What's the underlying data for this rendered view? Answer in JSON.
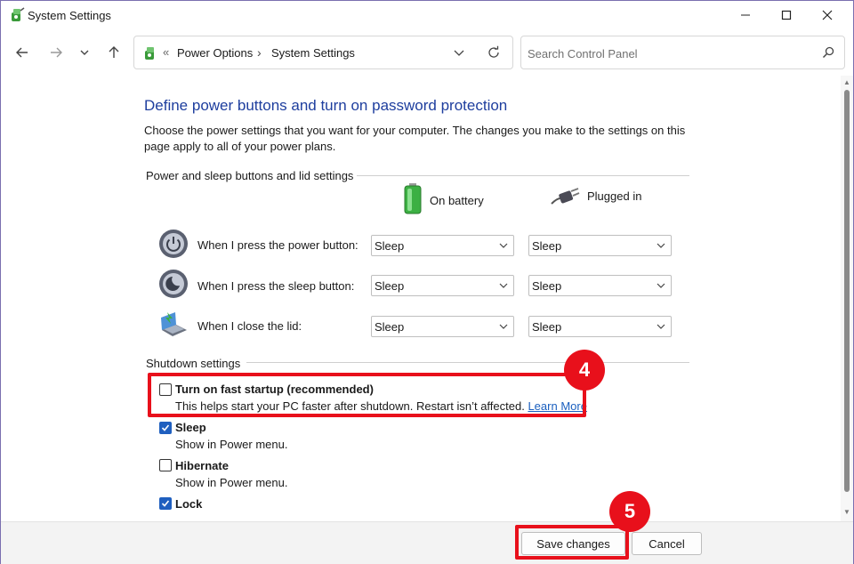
{
  "window": {
    "title": "System Settings",
    "min_icon": "minimize-icon",
    "max_icon": "maximize-icon",
    "close_icon": "close-icon"
  },
  "nav": {
    "back_icon": "back-arrow-icon",
    "forward_icon": "forward-arrow-icon",
    "recent_icon": "chevron-down-icon",
    "up_icon": "up-arrow-icon",
    "breadcrumb": [
      "Power Options",
      "System Settings"
    ],
    "overflow_chevron": "«",
    "separator": "›",
    "search_placeholder": "Search Control Panel"
  },
  "page": {
    "title": "Define power buttons and turn on password protection",
    "description": "Choose the power settings that you want for your computer. The changes you make to the settings on this page apply to all of your power plans."
  },
  "power_group": {
    "heading": "Power and sleep buttons and lid settings",
    "columns": {
      "battery": "On battery",
      "plugged": "Plugged in"
    },
    "rows": [
      {
        "label": "When I press the power button:",
        "icon": "power-button-icon",
        "battery": "Sleep",
        "plugged": "Sleep"
      },
      {
        "label": "When I press the sleep button:",
        "icon": "sleep-button-icon",
        "battery": "Sleep",
        "plugged": "Sleep"
      },
      {
        "label": "When I close the lid:",
        "icon": "laptop-lid-icon",
        "battery": "Sleep",
        "plugged": "Sleep"
      }
    ]
  },
  "shutdown_group": {
    "heading": "Shutdown settings",
    "options": [
      {
        "label": "Turn on fast startup (recommended)",
        "desc": "This helps start your PC faster after shutdown. Restart isn’t affected.",
        "link": "Learn More",
        "checked": false
      },
      {
        "label": "Sleep",
        "desc": "Show in Power menu.",
        "checked": true
      },
      {
        "label": "Hibernate",
        "desc": "Show in Power menu.",
        "checked": false
      },
      {
        "label": "Lock",
        "checked": true
      }
    ]
  },
  "annotations": {
    "step4": "4",
    "step5": "5",
    "highlight_color": "#e8101b"
  },
  "footer": {
    "save_label": "Save changes",
    "cancel_label": "Cancel"
  },
  "colors": {
    "title_blue": "#1e3e9e",
    "link_blue": "#1a5fbf",
    "checkbox_blue": "#1f5fbf"
  }
}
